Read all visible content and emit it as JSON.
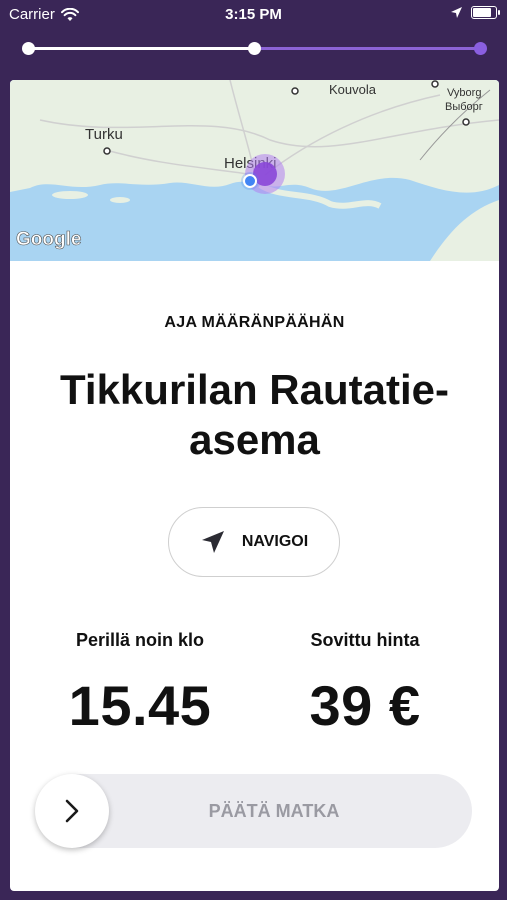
{
  "status_bar": {
    "carrier": "Carrier",
    "time": "3:15 PM",
    "battery_level": 0.75
  },
  "progress": {
    "steps": 3,
    "current_step": 2,
    "fraction_complete": 0.5
  },
  "map": {
    "attribution": "Google",
    "labels": {
      "turku": "Turku",
      "helsinki": "Helsinki",
      "kouvola": "Kouvola",
      "vyborg": "Vyborg",
      "vyborg_cyrillic": "Выборг"
    },
    "colors": {
      "land": "#e8f0e3",
      "water": "#a9d4f2",
      "marker": "#8a46d8",
      "user": "#4285f4"
    }
  },
  "trip": {
    "kicker": "AJA MÄÄRÄNPÄÄHÄN",
    "destination": "Tikkurilan Rautatie-asema",
    "navigate_label": "NAVIGOI",
    "arrival_label": "Perillä noin klo",
    "arrival_time": "15.45",
    "price_label": "Sovittu hinta",
    "price": "39 €",
    "end_trip_label": "PÄÄTÄ MATKA"
  },
  "icons": {
    "wifi": "wifi-icon",
    "location": "location-arrow-icon",
    "battery": "battery-icon",
    "navigate": "navigation-arrow-icon",
    "slider": "chevron-right-icon"
  },
  "colors": {
    "background": "#3a2657",
    "accent": "#8a5fe0",
    "card": "#ffffff",
    "slider_track": "#ececf0"
  }
}
